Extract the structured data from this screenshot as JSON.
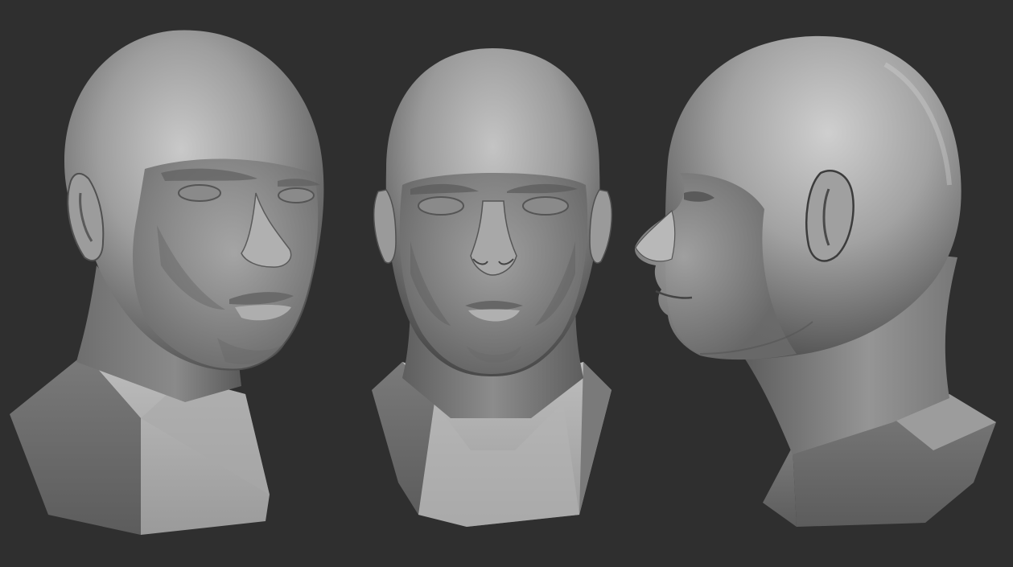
{
  "scene": {
    "background_color": "#2f2f2f",
    "material_color": "#9a9a9a",
    "views": [
      {
        "name": "three-quarter-view",
        "label": "three-quarter"
      },
      {
        "name": "front-view",
        "label": "front"
      },
      {
        "name": "profile-view",
        "label": "profile"
      }
    ]
  }
}
